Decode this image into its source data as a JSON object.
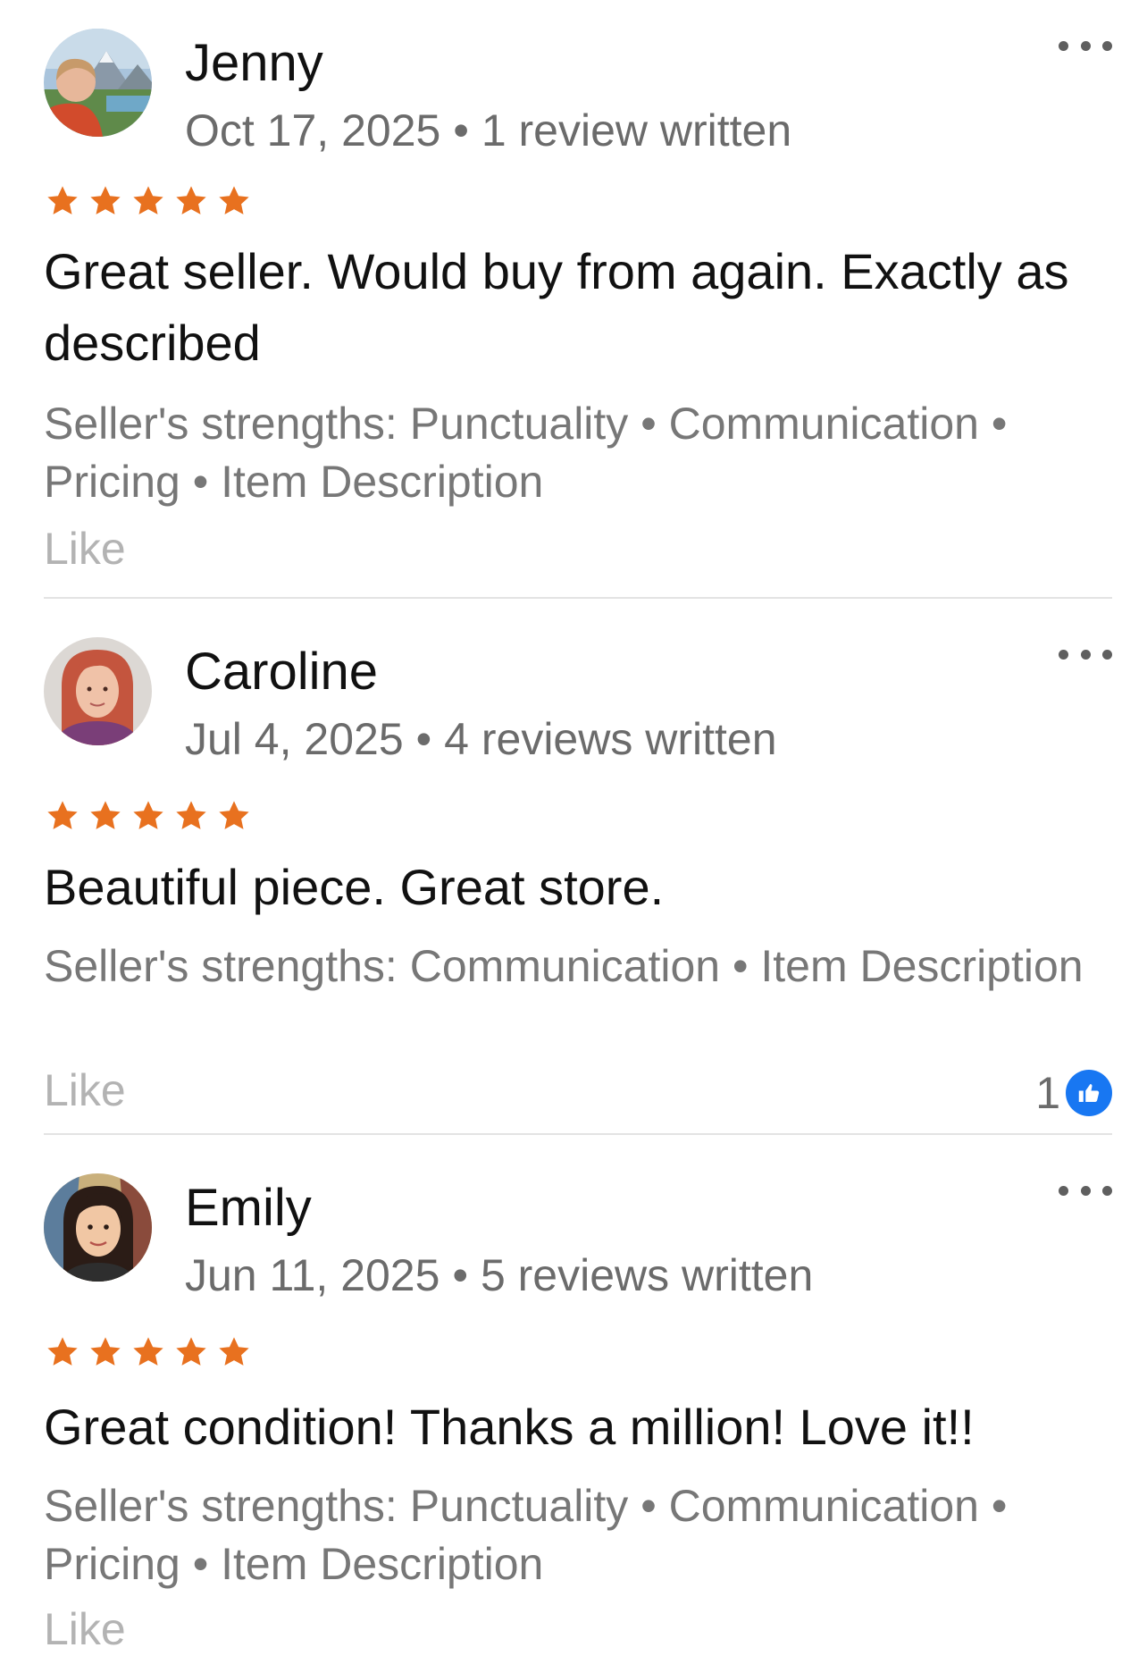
{
  "colors": {
    "star": "#e8711f",
    "like_badge": "#1877f2",
    "secondary_text": "#6b6b6b",
    "like_text": "#b3b3b3"
  },
  "reviews": [
    {
      "name": "Jenny",
      "date": "Oct 17, 2025",
      "separator": "•",
      "reviews_written": "1 review written",
      "rating": 5,
      "text": "Great seller. Would buy from again. Exactly as described",
      "strengths": "Seller's strengths: Punctuality • Communication • Pricing • Item Description",
      "like_label": "Like"
    },
    {
      "name": "Caroline",
      "date": "Jul 4, 2025",
      "separator": "•",
      "reviews_written": "4 reviews written",
      "rating": 5,
      "text": "Beautiful piece. Great store.",
      "strengths": "Seller's strengths: Communication • Item Description",
      "like_label": "Like",
      "like_count": "1",
      "like_icon": "thumbs-up-icon"
    },
    {
      "name": "Emily",
      "date": "Jun 11, 2025",
      "separator": "•",
      "reviews_written": "5 reviews written",
      "rating": 5,
      "text": "Great condition! Thanks a million! Love it!!",
      "strengths": "Seller's strengths: Punctuality • Communication • Pricing • Item Description",
      "like_label": "Like"
    }
  ]
}
